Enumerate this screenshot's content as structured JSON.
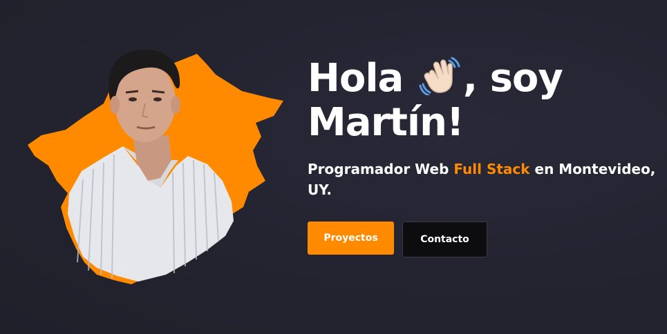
{
  "hero": {
    "greeting_start": "Hola",
    "greeting_end": ", soy Martín!",
    "greeting_emoji": "waving-hand",
    "tagline_prefix": "Programador Web ",
    "tagline_highlight": "Full Stack",
    "tagline_suffix": " en Montevideo, UY.",
    "photo_alt": "Martín"
  },
  "buttons": {
    "projects_label": "Proyectos",
    "contact_label": "Contacto"
  },
  "colors": {
    "background": "#23232f",
    "accent": "#ff8a00",
    "text": "#ffffff",
    "secondary_button": "#0d0d10"
  }
}
